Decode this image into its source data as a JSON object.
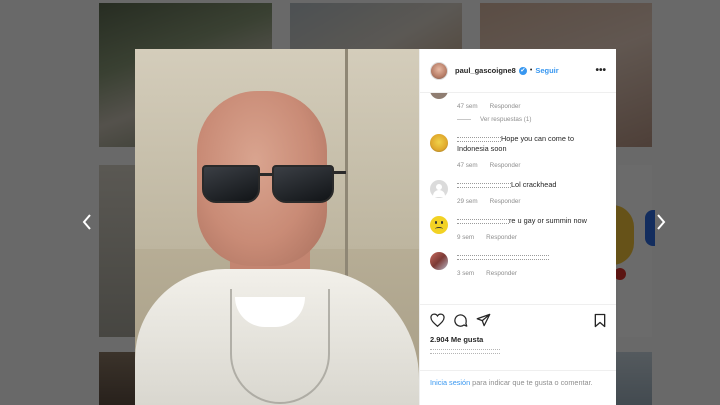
{
  "post": {
    "username": "paul_gascoigne8",
    "verified_badge": "✔",
    "separator": "•",
    "follow_label": "Seguir",
    "more_label": "•••",
    "likes": "2.904 Me gusta"
  },
  "comments": [
    {
      "text_suffix": "",
      "time": "47 sem",
      "reply": "Responder",
      "view_replies": "Ver respuestas (1)",
      "avatar_color": "#8f7d71"
    },
    {
      "text_suffix": "Hope you can come to Indonesia soon",
      "time": "47 sem",
      "reply": "Responder",
      "avatar_color": "#e8c542"
    },
    {
      "text_suffix": "Lol crackhead",
      "time": "29 sem",
      "reply": "Responder",
      "avatar_color": "#d9d9d9"
    },
    {
      "text_suffix": "re u gay or summin now",
      "time": "9 sem",
      "reply": "Responder",
      "avatar_color": "#f2d224"
    },
    {
      "text_suffix": "",
      "time": "3 sem",
      "reply": "Responder",
      "avatar_color": "#a0524d"
    }
  ],
  "footer": {
    "login_label": "Inicia sesión",
    "prompt": " para indicar que te gusta o comentar."
  },
  "icons": {
    "like": "heart-icon",
    "comment": "comment-icon",
    "share": "share-icon",
    "save": "bookmark-icon",
    "prev": "chevron-left-icon",
    "next": "chevron-right-icon"
  },
  "colors": {
    "link_blue": "#3897f0",
    "text_dark": "#262626",
    "text_muted": "#8e8e8e",
    "overlay": "rgba(0,0,0,0.58)"
  }
}
